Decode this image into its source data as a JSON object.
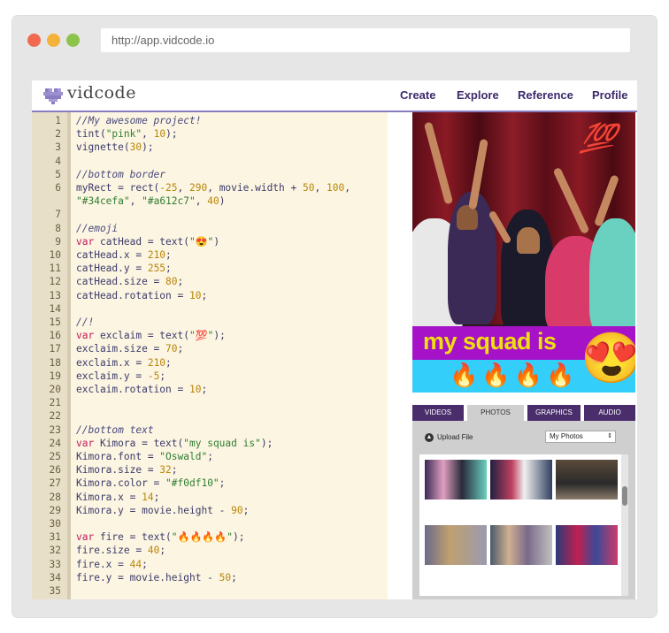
{
  "browser": {
    "url": "http://app.vidcode.io"
  },
  "nav": {
    "brand": "vidcode",
    "links": [
      "Create",
      "Explore",
      "Reference",
      "Profile"
    ]
  },
  "editor": {
    "lines": [
      {
        "n": "1",
        "t": "//My awesome project!",
        "k": "com"
      },
      {
        "n": "2",
        "t": "tint(\"pink\", 10);",
        "k": "code"
      },
      {
        "n": "3",
        "t": "vignette(30);",
        "k": "code"
      },
      {
        "n": "4",
        "t": "",
        "k": "code"
      },
      {
        "n": "5",
        "t": "//bottom border",
        "k": "com"
      },
      {
        "n": "6",
        "t": "myRect = rect(-25, 290, movie.width + 50, 100,",
        "k": "code"
      },
      {
        "n": "7",
        "t": "\"#34cefa\", \"#a612c7\", 40)",
        "k": "code",
        "noNum": true
      },
      {
        "n": "7",
        "t": "",
        "k": "code"
      },
      {
        "n": "8",
        "t": "//emoji",
        "k": "com"
      },
      {
        "n": "9",
        "t": "var catHead = text(\"😍\")",
        "k": "code"
      },
      {
        "n": "10",
        "t": "catHead.x = 210;",
        "k": "code"
      },
      {
        "n": "11",
        "t": "catHead.y = 255;",
        "k": "code"
      },
      {
        "n": "12",
        "t": "catHead.size = 80;",
        "k": "code"
      },
      {
        "n": "13",
        "t": "catHead.rotation = 10;",
        "k": "code"
      },
      {
        "n": "14",
        "t": "",
        "k": "code"
      },
      {
        "n": "15",
        "t": "//!",
        "k": "com"
      },
      {
        "n": "16",
        "t": "var exclaim = text(\"💯\");",
        "k": "code"
      },
      {
        "n": "17",
        "t": "exclaim.size = 70;",
        "k": "code"
      },
      {
        "n": "18",
        "t": "exclaim.x = 210;",
        "k": "code"
      },
      {
        "n": "19",
        "t": "exclaim.y = -5;",
        "k": "code"
      },
      {
        "n": "20",
        "t": "exclaim.rotation = 10;",
        "k": "code"
      },
      {
        "n": "21",
        "t": "",
        "k": "code"
      },
      {
        "n": "22",
        "t": "",
        "k": "code"
      },
      {
        "n": "23",
        "t": "//bottom text",
        "k": "com"
      },
      {
        "n": "24",
        "t": "var Kimora = text(\"my squad is\");",
        "k": "code"
      },
      {
        "n": "25",
        "t": "Kimora.font = \"Oswald\";",
        "k": "code"
      },
      {
        "n": "26",
        "t": "Kimora.size = 32;",
        "k": "code"
      },
      {
        "n": "27",
        "t": "Kimora.color = \"#f0df10\";",
        "k": "code"
      },
      {
        "n": "28",
        "t": "Kimora.x = 14;",
        "k": "code"
      },
      {
        "n": "29",
        "t": "Kimora.y = movie.height - 90;",
        "k": "code"
      },
      {
        "n": "30",
        "t": "",
        "k": "code"
      },
      {
        "n": "31",
        "t": "var fire = text(\"🔥🔥🔥🔥\");",
        "k": "code"
      },
      {
        "n": "32",
        "t": "fire.size = 40;",
        "k": "code"
      },
      {
        "n": "33",
        "t": "fire.x = 44;",
        "k": "code"
      },
      {
        "n": "34",
        "t": "fire.y = movie.height - 50;",
        "k": "code"
      },
      {
        "n": "35",
        "t": "",
        "k": "code"
      }
    ]
  },
  "preview": {
    "overlay_text": "my squad is",
    "hundred": "💯",
    "fire": "🔥🔥🔥🔥",
    "emoji": "😍",
    "colors": {
      "band_top": "#a612c7",
      "band_bottom": "#34cefa",
      "text": "#f0df10"
    }
  },
  "media_panel": {
    "tabs": [
      "VIDEOS",
      "PHOTOS",
      "GRAPHICS",
      "AUDIO"
    ],
    "active_tab": "PHOTOS",
    "upload_label": "Upload File",
    "library_select": "My Photos"
  }
}
